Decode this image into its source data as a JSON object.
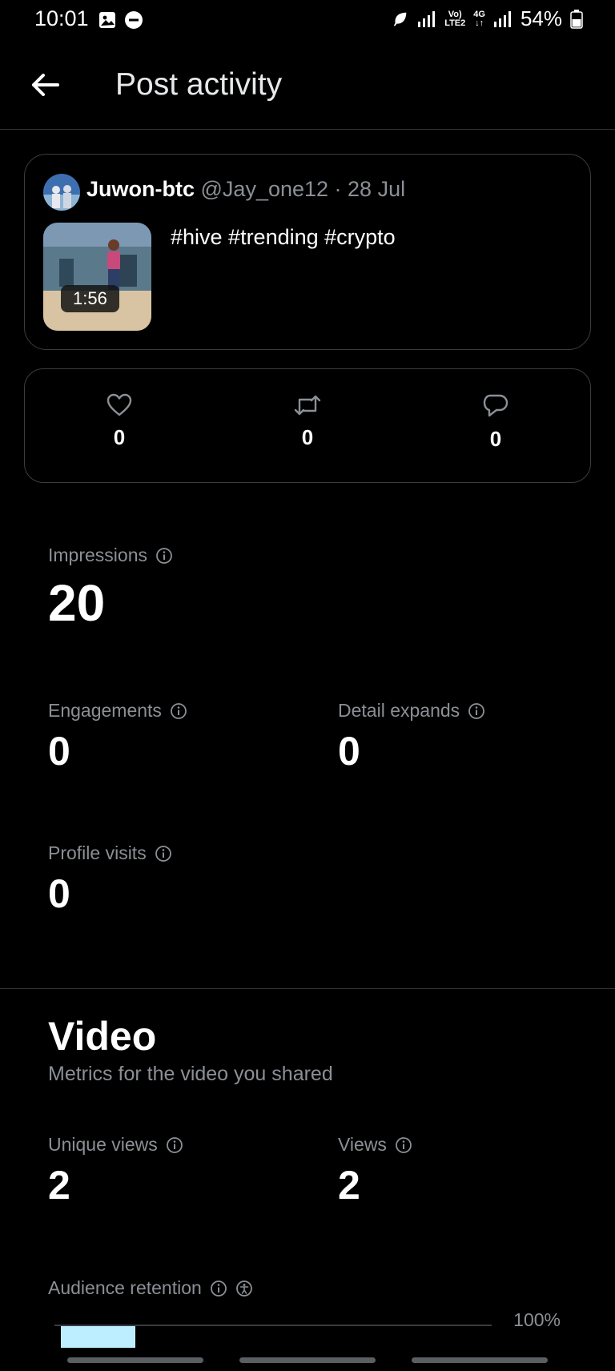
{
  "status_bar": {
    "time": "10:01",
    "network_top": "Vo)",
    "network_bottom": "LTE2",
    "network_type": "4G",
    "battery": "54%"
  },
  "header": {
    "title": "Post activity"
  },
  "post": {
    "author_name": "Juwon-btc",
    "meta": "@Jay_one12 · 28 Jul",
    "text": "#hive #trending #crypto",
    "video_duration": "1:56"
  },
  "engagement": {
    "likes": "0",
    "reposts": "0",
    "replies": "0"
  },
  "metrics": {
    "impressions_label": "Impressions",
    "impressions_value": "20",
    "engagements_label": "Engagements",
    "engagements_value": "0",
    "detail_expands_label": "Detail expands",
    "detail_expands_value": "0",
    "profile_visits_label": "Profile visits",
    "profile_visits_value": "0"
  },
  "video": {
    "title": "Video",
    "subtitle": "Metrics for the video you shared",
    "unique_views_label": "Unique views",
    "unique_views_value": "2",
    "views_label": "Views",
    "views_value": "2",
    "retention_label": "Audience retention",
    "retention_max_label": "100%",
    "retention_fraction": 0.17
  },
  "colors": {
    "background": "#000000",
    "retention_bar": "#bdeeff",
    "secondary_text": "#8b9095"
  }
}
